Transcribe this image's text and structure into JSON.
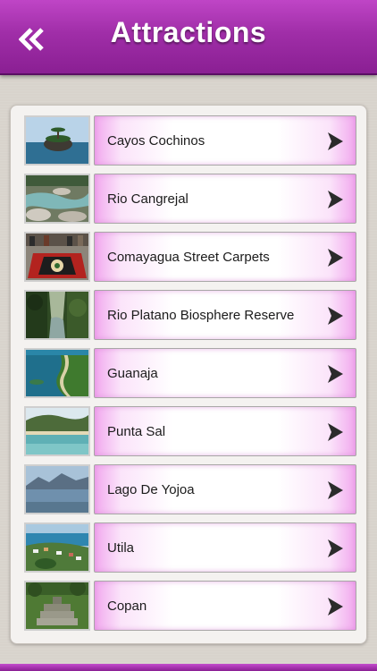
{
  "header": {
    "title": "Attractions",
    "back_icon": "double-chevron-left-icon"
  },
  "attractions": [
    {
      "label": "Cayos Cochinos",
      "scene": "island"
    },
    {
      "label": "Rio Cangrejal",
      "scene": "river"
    },
    {
      "label": "Comayagua Street Carpets",
      "scene": "carpet"
    },
    {
      "label": "Rio Platano Biosphere Reserve",
      "scene": "jungle"
    },
    {
      "label": "Guanaja",
      "scene": "coast"
    },
    {
      "label": "Punta Sal",
      "scene": "beach"
    },
    {
      "label": "Lago De Yojoa",
      "scene": "lake"
    },
    {
      "label": "Utila",
      "scene": "town"
    },
    {
      "label": "Copan",
      "scene": "ruins"
    }
  ],
  "colors": {
    "header": "#a02ea8",
    "button_glow": "#f1a8ee",
    "arrow": "#2b2b2b"
  }
}
